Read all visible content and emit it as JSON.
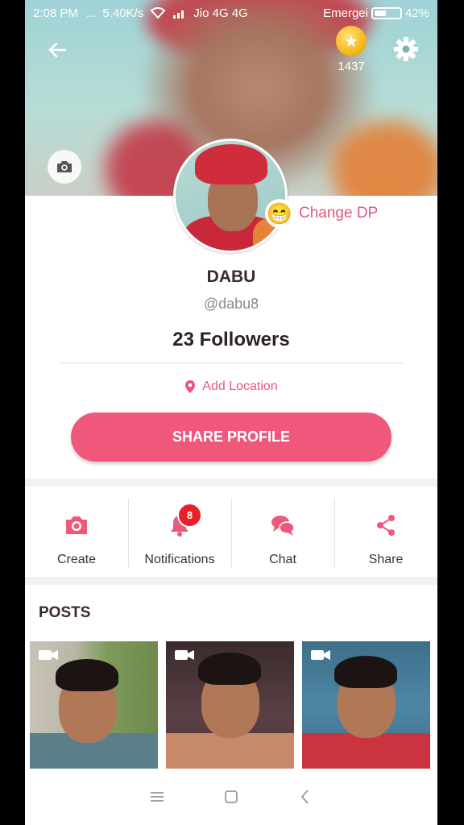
{
  "status_bar": {
    "time": "2:08 PM",
    "dots": "...",
    "speed": "5.40K/s",
    "carrier": "Jio 4G 4G",
    "emergency": "Emergei",
    "battery": "42%"
  },
  "header": {
    "coins": "1437",
    "icons": [
      "back-arrow-icon",
      "coin-icon",
      "gear-icon",
      "camera-icon"
    ]
  },
  "profile": {
    "change_dp_label": "Change DP",
    "change_dp_emoji": "😁",
    "name": "DABU",
    "handle": "@dabu8",
    "followers": "23 Followers",
    "add_location": "Add Location",
    "share_profile": "SHARE PROFILE"
  },
  "actions": [
    {
      "label": "Create",
      "icon": "camera-icon"
    },
    {
      "label": "Notifications",
      "icon": "bell-icon",
      "badge": "8"
    },
    {
      "label": "Chat",
      "icon": "chat-icon"
    },
    {
      "label": "Share",
      "icon": "share-icon"
    }
  ],
  "posts": {
    "title": "POSTS",
    "items": [
      {
        "type": "video"
      },
      {
        "type": "video"
      },
      {
        "type": "video"
      }
    ]
  },
  "colors": {
    "accent": "#f0587b",
    "accent_text": "#e8577a",
    "badge": "#e8202c",
    "background": "#ffffff"
  }
}
